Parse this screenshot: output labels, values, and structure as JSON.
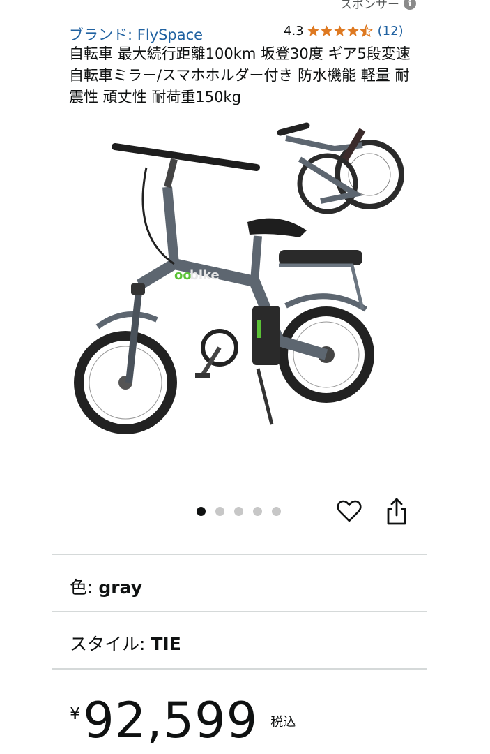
{
  "sponsored": {
    "label": "スポンサー"
  },
  "product": {
    "brand": "ブランド: FlySpace",
    "rating": "4.3",
    "review_count": "(12)",
    "title": "自転車 最大続行距離100km 坂登30度 ギア5段変速 自転車ミラー/スマホホルダー付き 防水機能 軽量 耐震性 頑丈性 耐荷重150kg",
    "image_logo_text": "bike"
  },
  "icons": {
    "info": "info-icon",
    "star": "star-icon",
    "heart": "heart-icon",
    "share": "share-icon"
  },
  "gallery": {
    "total": 5,
    "active_index": 0
  },
  "options": {
    "color_label": "色: ",
    "color_value": "gray",
    "style_label": "スタイル: ",
    "style_value": "TIE"
  },
  "price": {
    "currency": "¥",
    "amount": "92,599",
    "tax_label": "税込"
  },
  "colors": {
    "link": "#2162a1",
    "star": "#de7921",
    "text": "#0f1111",
    "divider": "#d5d9d9"
  }
}
